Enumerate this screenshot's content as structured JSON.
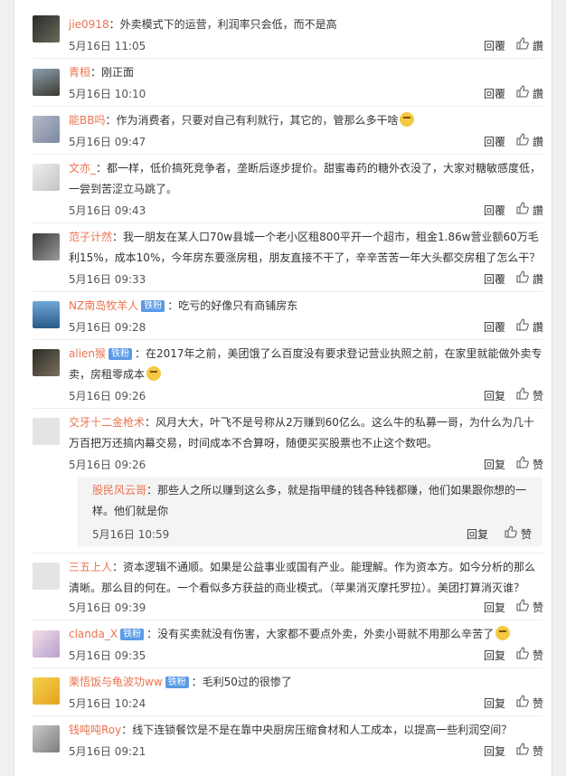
{
  "comments": [
    {
      "user": "jie0918",
      "badge": "",
      "text": "：外卖模式下的运营，利润率只会低，而不是高",
      "time": "5月16日 11:05",
      "reply": "回覆",
      "like": "讚"
    },
    {
      "user": "青桓",
      "badge": "",
      "text": "：刚正面",
      "time": "5月16日 10:10",
      "reply": "回覆",
      "like": "讚"
    },
    {
      "user": "能BB吗",
      "badge": "",
      "text": "：作为消费者，只要对自己有利就行，其它的，管那么多干啥",
      "time": "5月16日 09:47",
      "reply": "回覆",
      "like": "讚"
    },
    {
      "user": "文亦_",
      "badge": "",
      "text": "：都一样，低价搞死竞争者，垄断后逐步提价。甜蜜毒药的糖外衣没了，大家对糖敏感度低，一尝到苦涩立马跳了。",
      "time": "5月16日 09:43",
      "reply": "回覆",
      "like": "讚"
    },
    {
      "user": "范子计然",
      "badge": "",
      "text": "：我一朋友在某人口70w县城一个老小区租800平开一个超市，租金1.86w营业额60万毛利15%，成本10%，今年房东要涨房租，朋友直接不干了，辛辛苦苦一年大头都交房租了怎么干？",
      "time": "5月16日 09:33",
      "reply": "回覆",
      "like": "讚"
    },
    {
      "user": "NZ南岛牧羊人",
      "badge": "铁粉",
      "text": "：吃亏的好像只有商铺房东",
      "time": "5月16日 09:28",
      "reply": "回覆",
      "like": "讚"
    },
    {
      "user": "alien猴",
      "badge": "铁粉",
      "text": "：在2017年之前，美团饿了么百度没有要求登记营业执照之前，在家里就能做外卖专卖，房租零成本",
      "time": "5月16日 09:26",
      "reply": "回复",
      "like": "赞"
    },
    {
      "user": "交牙十二金枪术",
      "badge": "",
      "text": "：风月大大，叶飞不是号称从2万赚到60亿么。这么牛的私募一哥，为什么为几十万百把万还搞内幕交易，时间成本不合算呀，随便买买股票也不止这个数吧。",
      "time": "5月16日 09:26",
      "reply": "回复",
      "like": "赞"
    },
    {
      "user": "三五上人",
      "badge": "",
      "text": "：资本逻辑不通顺。如果是公益事业或国有产业。能理解。作为资本方。如今分析的那么清晰。那么目的何在。一个看似多方获益的商业模式。（苹果消灭摩托罗拉）。美团打算消灭谁？",
      "time": "5月16日 09:39",
      "reply": "回复",
      "like": "赞"
    },
    {
      "user": "clanda_X",
      "badge": "铁粉",
      "text": "：没有买卖就没有伤害，大家都不要点外卖，外卖小哥就不用那么辛苦了",
      "time": "5月16日 09:35",
      "reply": "回复",
      "like": "赞"
    },
    {
      "user": "栗悟饭与龟波功ww",
      "badge": "铁粉",
      "text": "：毛利50过的很惨了",
      "time": "5月16日 10:24",
      "reply": "回复",
      "like": "赞"
    },
    {
      "user": "钱吨吨Roy",
      "badge": "",
      "text": "：线下连锁餐饮是不是在靠中央厨房压缩食材和人工成本，以提高一些利润空间？",
      "time": "5月16日 09:21",
      "reply": "回复",
      "like": "赞"
    }
  ],
  "subreply": {
    "user": "股民风云哥",
    "text": "：那些人之所以赚到这么多，就是指甲缝的钱各种钱都赚，他们如果跟你想的一样。他们就是你",
    "time": "5月16日 10:59",
    "reply": "回复",
    "like": "赞"
  }
}
